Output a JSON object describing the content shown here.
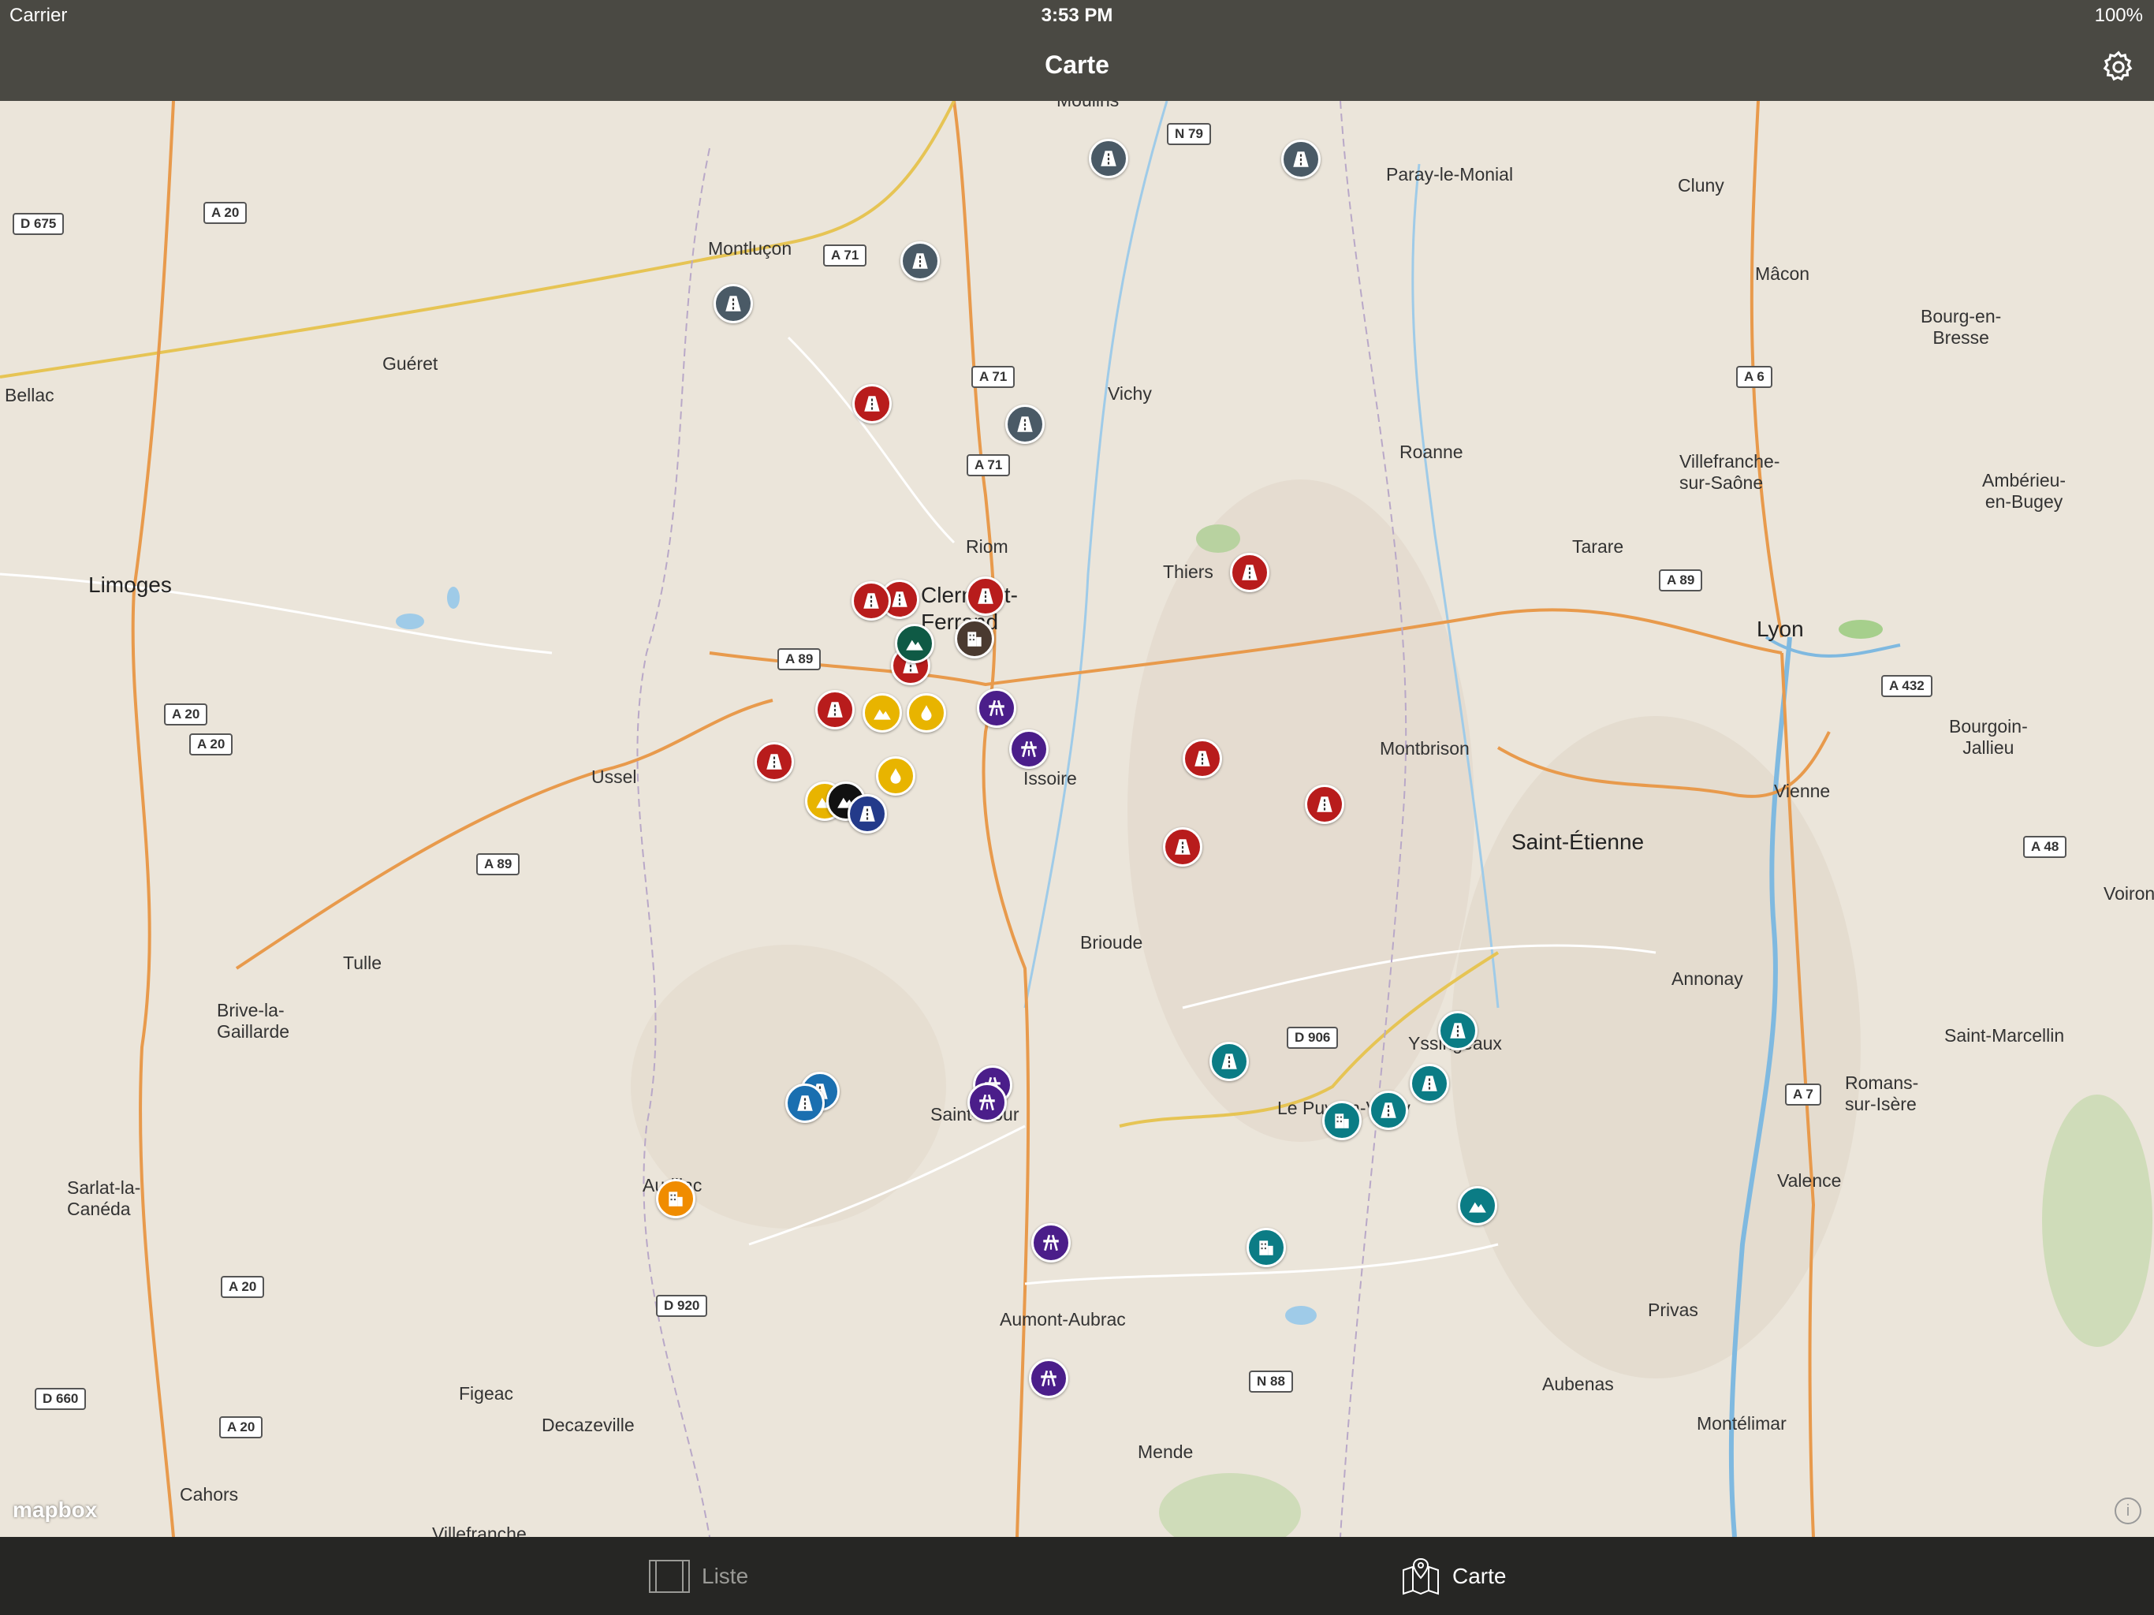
{
  "status_bar": {
    "carrier": "Carrier",
    "time": "3:53 PM",
    "battery": "100%"
  },
  "nav": {
    "title": "Carte",
    "settings_icon": "gear-icon"
  },
  "map": {
    "attribution": "mapbox",
    "info_label": "i",
    "cities": [
      {
        "name": "Montluçon"
      },
      {
        "name": "Guéret"
      },
      {
        "name": "Bellac"
      },
      {
        "name": "Limoges"
      },
      {
        "name": "Ussel"
      },
      {
        "name": "Tulle"
      },
      {
        "name": "Brive-la-\nGaillarde"
      },
      {
        "name": "Sarlat-la-\nCanéda"
      },
      {
        "name": "Figeac"
      },
      {
        "name": "Decazeville"
      },
      {
        "name": "Cahors"
      },
      {
        "name": "Riom"
      },
      {
        "name": "Clermont-\nFerrand"
      },
      {
        "name": "Vichy"
      },
      {
        "name": "Thiers"
      },
      {
        "name": "Issoire"
      },
      {
        "name": "Brioude"
      },
      {
        "name": "Saint-Flour"
      },
      {
        "name": "Aurillac"
      },
      {
        "name": "Aumont-Aubrac"
      },
      {
        "name": "Mende"
      },
      {
        "name": "Le Puy-en-Velay"
      },
      {
        "name": "Yssingeaux"
      },
      {
        "name": "Montbrison"
      },
      {
        "name": "Roanne"
      },
      {
        "name": "Paray-le-Monial"
      },
      {
        "name": "Cluny"
      },
      {
        "name": "Mâcon"
      },
      {
        "name": "Bourg-en-\nBresse"
      },
      {
        "name": "Villefranche-\nsur-Saône"
      },
      {
        "name": "Tarare"
      },
      {
        "name": "Lyon"
      },
      {
        "name": "Ambérieu-\nen-Bugey"
      },
      {
        "name": "Bourgoin-\nJallieu"
      },
      {
        "name": "Vienne"
      },
      {
        "name": "Saint-Étienne"
      },
      {
        "name": "Annonay"
      },
      {
        "name": "Saint-Marcellin"
      },
      {
        "name": "Romans-\nsur-Isère"
      },
      {
        "name": "Valence"
      },
      {
        "name": "Privas"
      },
      {
        "name": "Aubenas"
      },
      {
        "name": "Montélimar"
      },
      {
        "name": "Voiron"
      },
      {
        "name": "Moulins"
      },
      {
        "name": "Villefranche"
      }
    ],
    "road_shields": [
      "D 675",
      "A 20",
      "A 71",
      "N 79",
      "A 71",
      "A 71",
      "A 89",
      "A 20",
      "A 20",
      "A 89",
      "A 6",
      "A 89",
      "A 432",
      "A 48",
      "D 906",
      "A 7",
      "A 20",
      "D 920",
      "D 660",
      "A 20",
      "N 88"
    ],
    "markers": [
      {
        "icon": "road-icon",
        "color": "#4a5a66"
      },
      {
        "icon": "road-icon",
        "color": "#4a5a66"
      },
      {
        "icon": "road-icon",
        "color": "#4a5a66"
      },
      {
        "icon": "road-icon",
        "color": "#4a5a66"
      },
      {
        "icon": "road-icon",
        "color": "#4a5a66"
      },
      {
        "icon": "road-icon",
        "color": "#b81c1c"
      },
      {
        "icon": "road-icon",
        "color": "#b81c1c"
      },
      {
        "icon": "road-icon",
        "color": "#b81c1c"
      },
      {
        "icon": "road-icon",
        "color": "#b81c1c"
      },
      {
        "icon": "road-icon",
        "color": "#b81c1c"
      },
      {
        "icon": "road-icon",
        "color": "#b81c1c"
      },
      {
        "icon": "road-icon",
        "color": "#b81c1c"
      },
      {
        "icon": "road-icon",
        "color": "#b81c1c"
      },
      {
        "icon": "road-icon",
        "color": "#b81c1c"
      },
      {
        "icon": "road-icon",
        "color": "#b81c1c"
      },
      {
        "icon": "road-icon",
        "color": "#b81c1c"
      },
      {
        "icon": "mountain-icon",
        "color": "#0f5a45"
      },
      {
        "icon": "building-icon",
        "color": "#4a3a30"
      },
      {
        "icon": "mountain-icon",
        "color": "#e8b400"
      },
      {
        "icon": "drop-icon",
        "color": "#e8b400"
      },
      {
        "icon": "drop-icon",
        "color": "#e8b400"
      },
      {
        "icon": "mountain-icon",
        "color": "#e8b400"
      },
      {
        "icon": "mountain-icon",
        "color": "#111111"
      },
      {
        "icon": "road-icon",
        "color": "#233a8a"
      },
      {
        "icon": "highway-icon",
        "color": "#4b1e8a"
      },
      {
        "icon": "highway-icon",
        "color": "#4b1e8a"
      },
      {
        "icon": "highway-icon",
        "color": "#4b1e8a"
      },
      {
        "icon": "highway-icon",
        "color": "#4b1e8a"
      },
      {
        "icon": "highway-icon",
        "color": "#4b1e8a"
      },
      {
        "icon": "highway-icon",
        "color": "#4b1e8a"
      },
      {
        "icon": "road-icon",
        "color": "#1a6fb0"
      },
      {
        "icon": "road-icon",
        "color": "#1a6fb0"
      },
      {
        "icon": "building-icon",
        "color": "#f08c00"
      },
      {
        "icon": "road-icon",
        "color": "#0b7c85"
      },
      {
        "icon": "road-icon",
        "color": "#0b7c85"
      },
      {
        "icon": "road-icon",
        "color": "#0b7c85"
      },
      {
        "icon": "road-icon",
        "color": "#0b7c85"
      },
      {
        "icon": "building-icon",
        "color": "#0b7c85"
      },
      {
        "icon": "building-icon",
        "color": "#0b7c85"
      },
      {
        "icon": "mountain-icon",
        "color": "#0b7c85"
      }
    ]
  },
  "tabs": [
    {
      "label": "Liste",
      "icon": "list-icon",
      "active": false
    },
    {
      "label": "Carte",
      "icon": "map-icon",
      "active": true
    }
  ]
}
